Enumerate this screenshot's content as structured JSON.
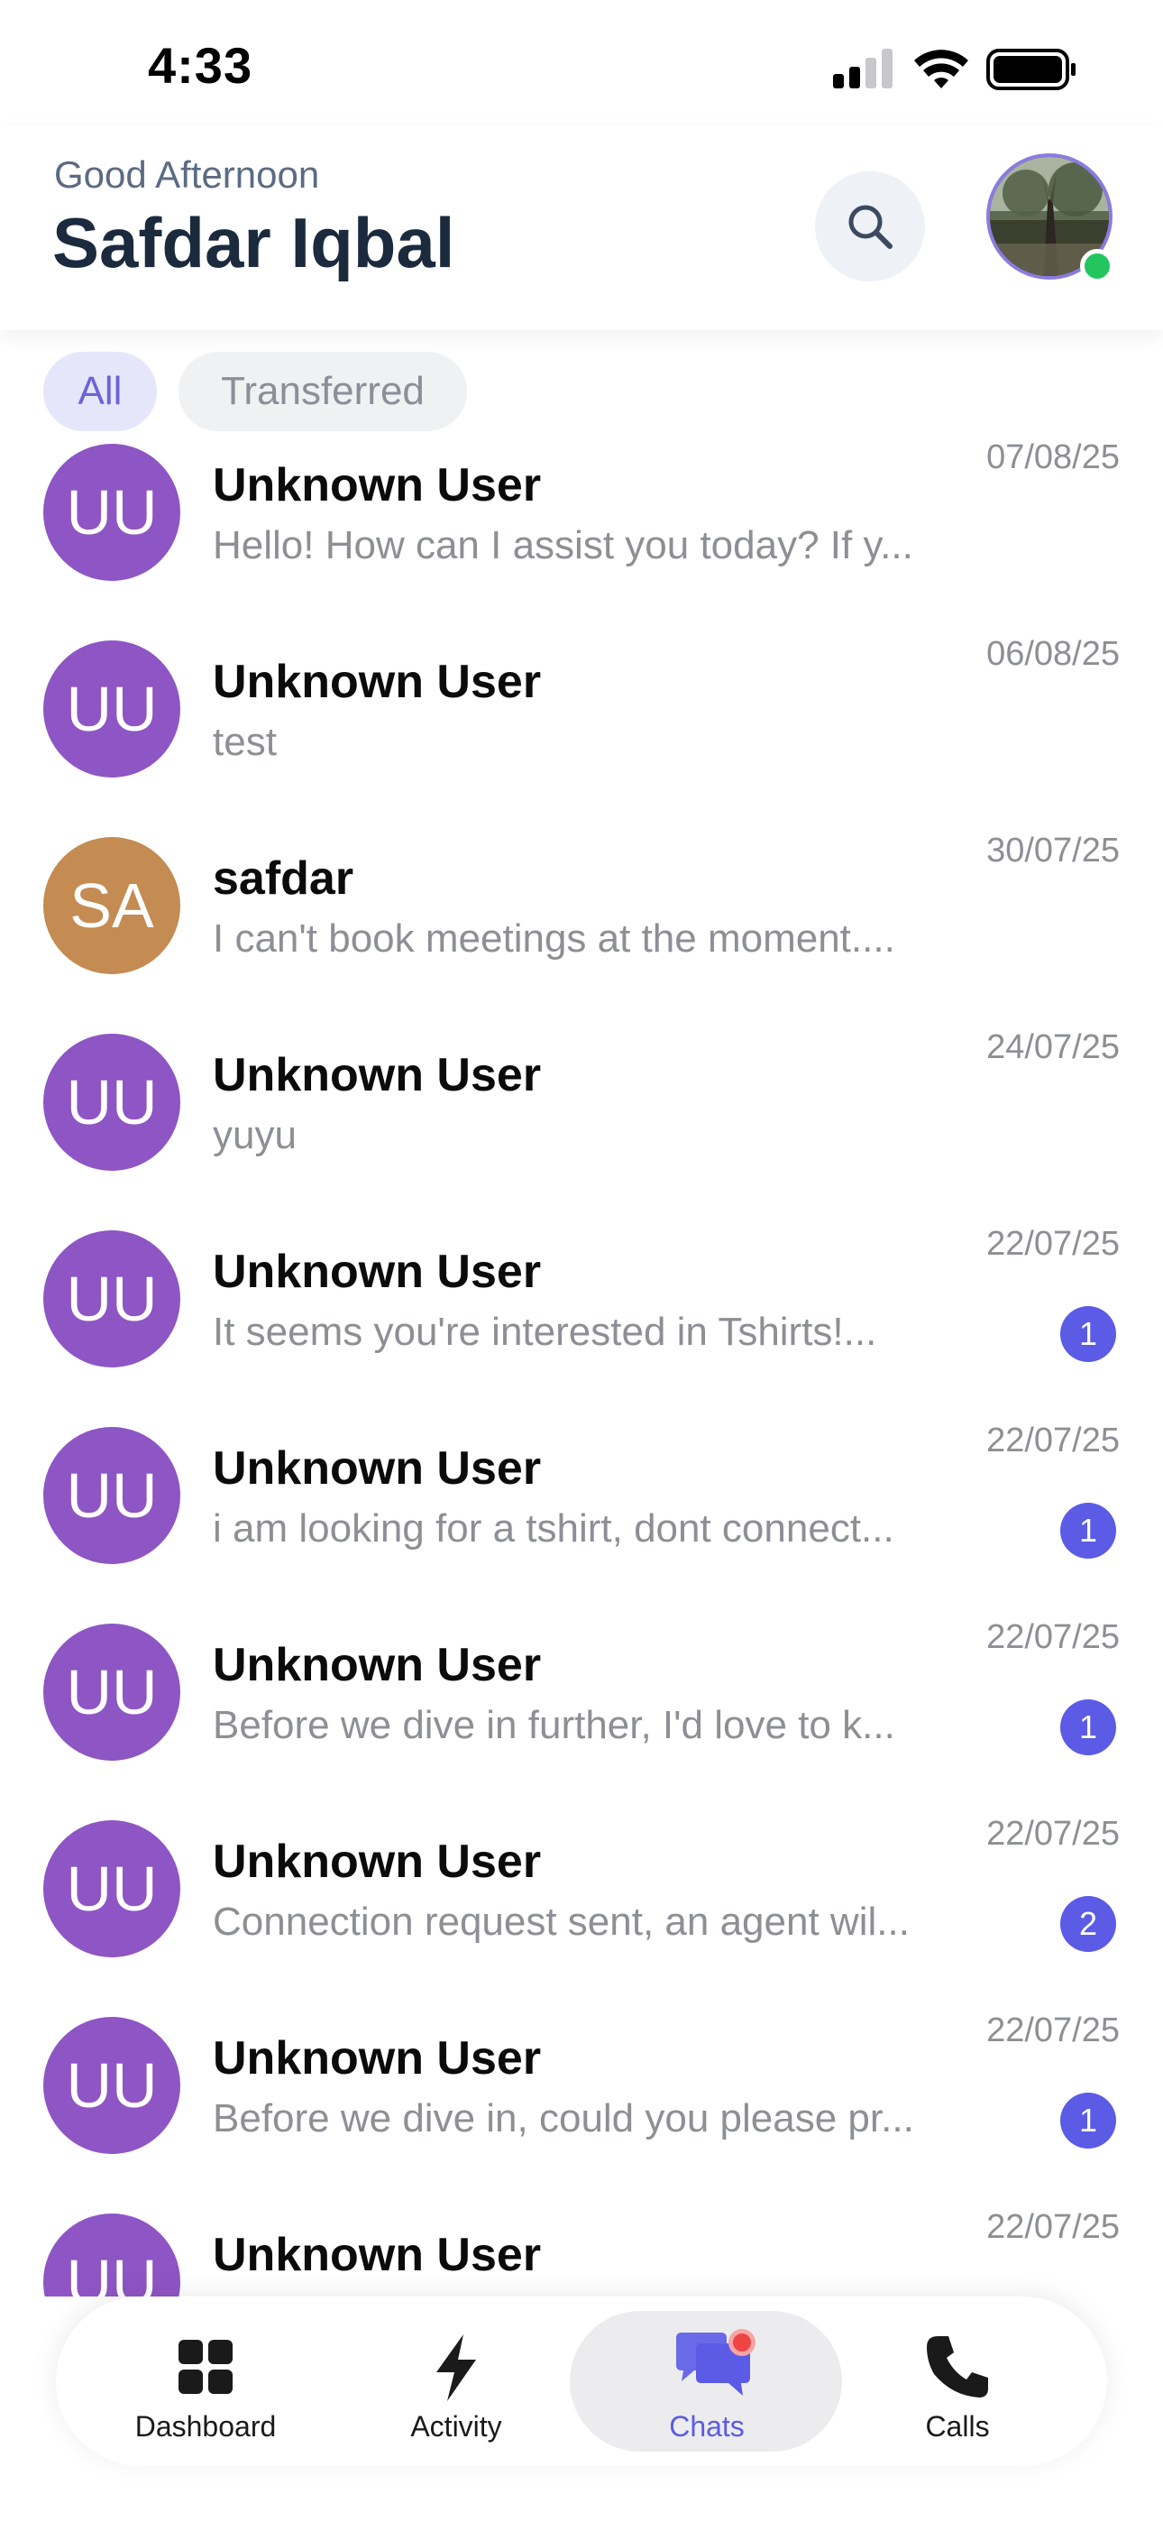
{
  "status_bar": {
    "time": "4:33"
  },
  "header": {
    "greeting": "Good Afternoon",
    "user_name": "Safdar Iqbal",
    "online": true
  },
  "filters": [
    {
      "label": "All",
      "active": true
    },
    {
      "label": "Transferred",
      "active": false
    }
  ],
  "chats": [
    {
      "initials": "UU",
      "name": "Unknown User",
      "preview": "Hello! How can I assist you today? If y...",
      "date": "07/08/25",
      "unread": "",
      "avatar_color": "#8e55c4"
    },
    {
      "initials": "UU",
      "name": "Unknown User",
      "preview": "test",
      "date": "06/08/25",
      "unread": "",
      "avatar_color": "#8e55c4"
    },
    {
      "initials": "SA",
      "name": "safdar",
      "preview": "I can't book meetings at the moment....",
      "date": "30/07/25",
      "unread": "",
      "avatar_color": "#c48b52"
    },
    {
      "initials": "UU",
      "name": "Unknown User",
      "preview": "yuyu",
      "date": "24/07/25",
      "unread": "",
      "avatar_color": "#8e55c4"
    },
    {
      "initials": "UU",
      "name": "Unknown User",
      "preview": "It seems you're interested in Tshirts!...",
      "date": "22/07/25",
      "unread": "1",
      "avatar_color": "#8e55c4"
    },
    {
      "initials": "UU",
      "name": "Unknown User",
      "preview": "i am looking for a tshirt, dont connect...",
      "date": "22/07/25",
      "unread": "1",
      "avatar_color": "#8e55c4"
    },
    {
      "initials": "UU",
      "name": "Unknown User",
      "preview": "Before we dive in further, I'd love to k...",
      "date": "22/07/25",
      "unread": "1",
      "avatar_color": "#8e55c4"
    },
    {
      "initials": "UU",
      "name": "Unknown User",
      "preview": "Connection request sent, an agent wil...",
      "date": "22/07/25",
      "unread": "2",
      "avatar_color": "#8e55c4"
    },
    {
      "initials": "UU",
      "name": "Unknown User",
      "preview": "Before we dive in, could you please pr...",
      "date": "22/07/25",
      "unread": "1",
      "avatar_color": "#8e55c4"
    },
    {
      "initials": "UU",
      "name": "Unknown User",
      "preview": "",
      "date": "22/07/25",
      "unread": "",
      "avatar_color": "#8e55c4"
    }
  ],
  "bottom_nav": [
    {
      "label": "Dashboard",
      "icon": "grid-icon",
      "active": false
    },
    {
      "label": "Activity",
      "icon": "lightning-icon",
      "active": false
    },
    {
      "label": "Chats",
      "icon": "chat-bubbles-icon",
      "active": true
    },
    {
      "label": "Calls",
      "icon": "phone-icon",
      "active": false
    }
  ],
  "colors": {
    "accent": "#5b5be6",
    "avatar_purple": "#8e55c4",
    "avatar_orange": "#c48b52",
    "online": "#22c55e"
  }
}
